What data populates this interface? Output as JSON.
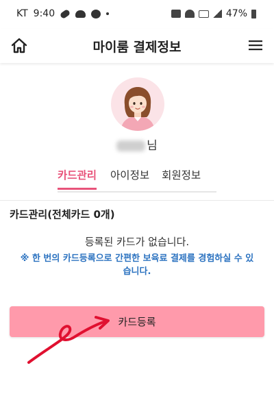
{
  "status_bar": {
    "carrier": "KT",
    "time": "9:40",
    "battery": "47%"
  },
  "header": {
    "title": "마이룸 결제정보"
  },
  "profile": {
    "suffix": "님"
  },
  "tabs": [
    {
      "label": "카드관리",
      "active": true
    },
    {
      "label": "아이정보",
      "active": false
    },
    {
      "label": "회원정보",
      "active": false
    }
  ],
  "card_section": {
    "title": "카드관리(전체카드 0개)",
    "empty_message": "등록된 카드가 없습니다.",
    "notice": "※ 한 번의 카드등록으로 간편한 보육료 결제를 경험하실 수 있습니다."
  },
  "register_button": {
    "label": "카드등록"
  },
  "colors": {
    "accent": "#e8537a",
    "button": "#ff9aab",
    "notice": "#2b72c0",
    "annotation": "#e01030"
  },
  "icons": [
    "pill-icon",
    "cloud-icon",
    "chat-icon",
    "mute-icon",
    "wifi-icon",
    "hd-icon",
    "signal-icon",
    "battery-icon",
    "home-icon",
    "menu-icon"
  ]
}
